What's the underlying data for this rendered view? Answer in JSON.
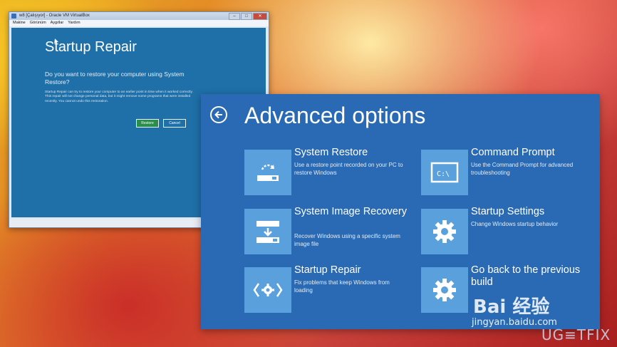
{
  "vm_window": {
    "title": "w8 [Çalışıyor] - Oracle VM VirtualBox",
    "menu": [
      "Makine",
      "Görünüm",
      "Aygıtlar",
      "Yardım"
    ],
    "menu_display": [
      "Makine",
      "Görünüm",
      "Aygıtlar",
      "Yardım"
    ],
    "startup_repair": {
      "title": "Startup Repair",
      "question": "Do you want to restore your computer using System Restore?",
      "description": "Startup Repair can try to restore your computer to an earlier point in time when it worked correctly. This repair will not change personal data, but it might remove some programs that were installed recently. You cannot undo this restoration.",
      "restore_label": "Restore",
      "cancel_label": "Cancel"
    }
  },
  "advanced_options": {
    "title": "Advanced options",
    "tiles": [
      {
        "title": "System Restore",
        "desc": "Use a restore point recorded on your PC to restore Windows",
        "icon": "system-restore-icon"
      },
      {
        "title": "Command Prompt",
        "desc": "Use the Command Prompt for advanced troubleshooting",
        "icon": "command-prompt-icon"
      },
      {
        "title": "System Image Recovery",
        "desc": "Recover Windows using a specific system image file",
        "icon": "system-image-icon"
      },
      {
        "title": "Startup Settings",
        "desc": "Change Windows startup behavior",
        "icon": "gear-icon"
      },
      {
        "title": "Startup Repair",
        "desc": "Fix problems that keep Windows from loading",
        "icon": "startup-repair-icon"
      },
      {
        "title": "Go back to the previous build",
        "desc": "",
        "icon": "gear-icon"
      }
    ],
    "cmd_glyph": "C:\\"
  },
  "watermark": {
    "baidu": "Bai 经验",
    "baidu_url": "jingyan.baidu.com",
    "ugetfix": "UG≡TFIX"
  },
  "colors": {
    "panel": "#2a6ab4",
    "tile": "#5aa0dc",
    "vm_screen": "#1f6fa8"
  }
}
